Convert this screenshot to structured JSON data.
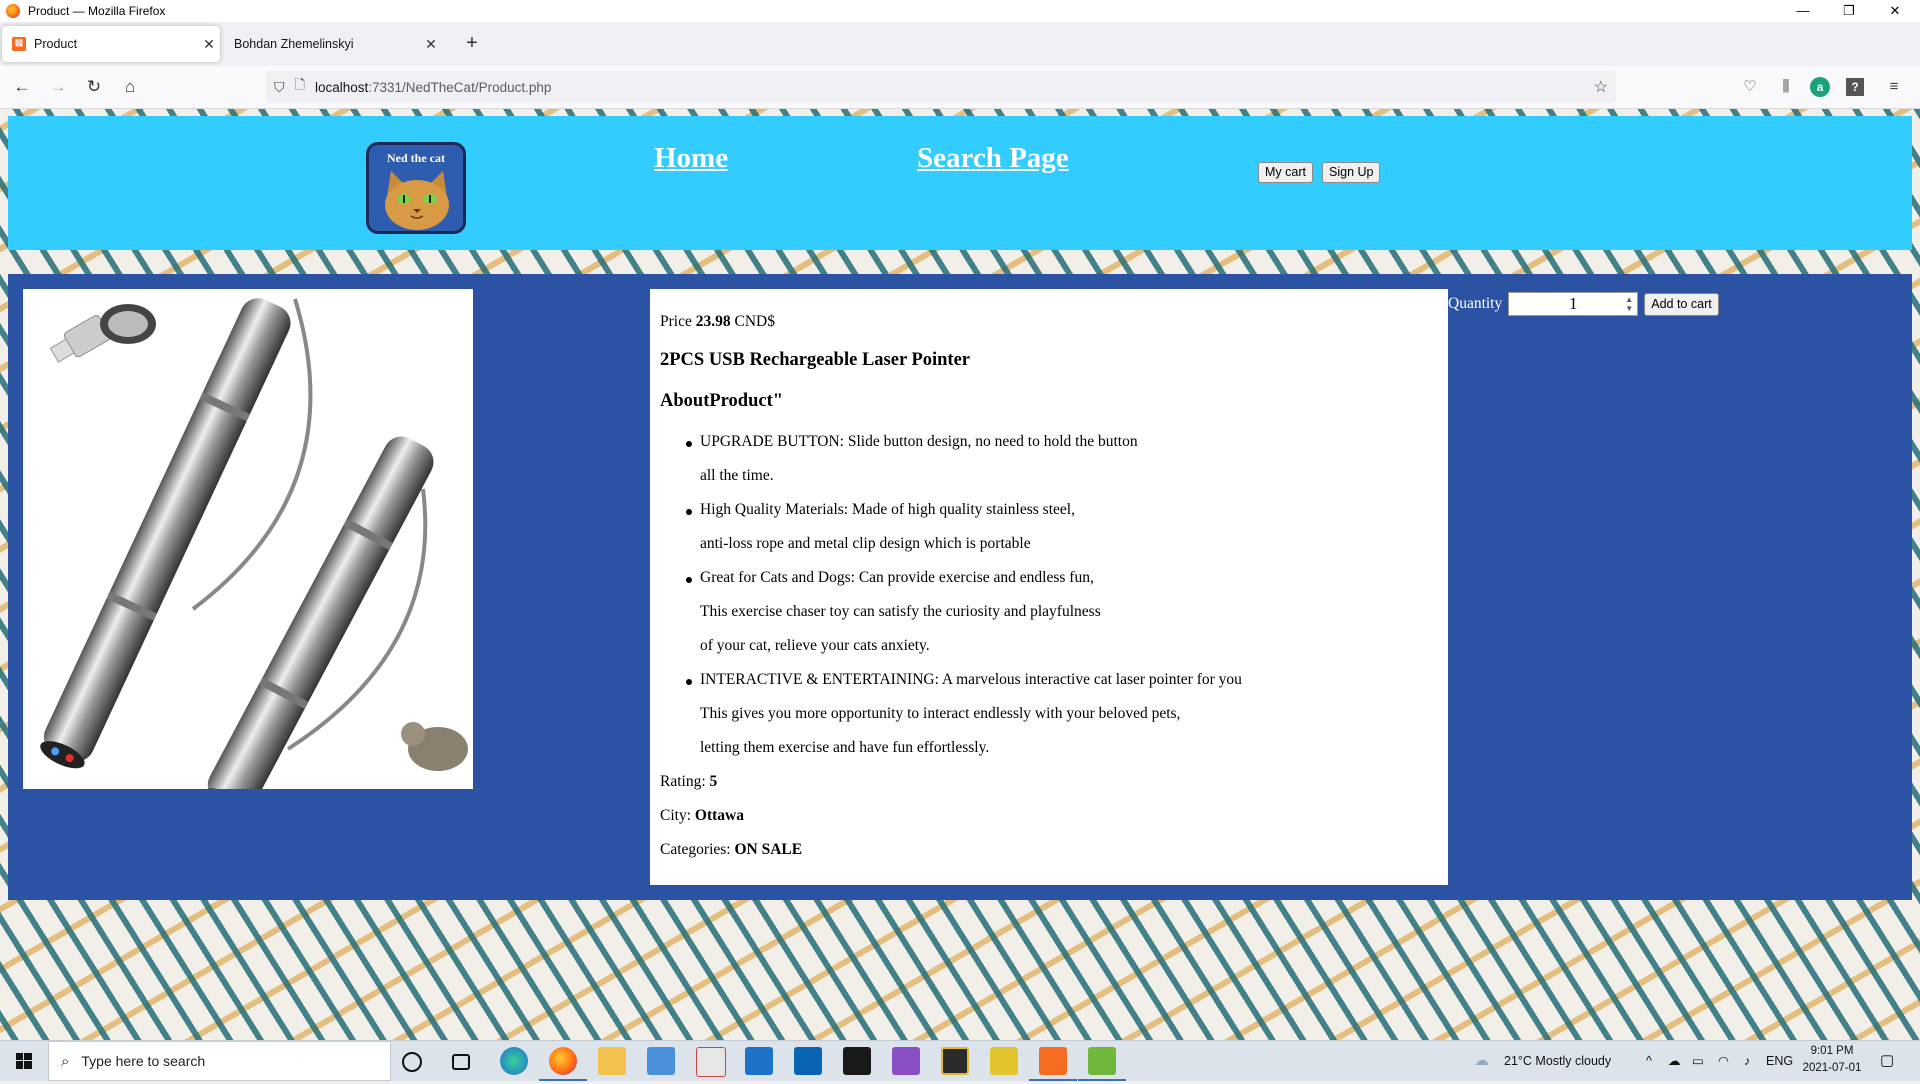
{
  "window": {
    "title": "Product — Mozilla Firefox",
    "controls": {
      "minimize": "—",
      "restore": "❐",
      "close": "✕"
    }
  },
  "tabs": [
    {
      "label": "Product",
      "active": true
    },
    {
      "label": "Bohdan Zhemelinskyi",
      "active": false
    }
  ],
  "navbar": {
    "url_host": "localhost",
    "url_rest": ":7331/NedTheCat/Product.php"
  },
  "site": {
    "logo_text": "Ned the cat",
    "nav": {
      "home": "Home",
      "search": "Search Page"
    },
    "buttons": {
      "cart": "My cart",
      "signup": "Sign Up"
    }
  },
  "product": {
    "price_label": "Price",
    "price_value": "23.98",
    "price_currency": "CND$",
    "name": "2PCS USB Rechargeable Laser Pointer",
    "about_heading": "AboutProduct\"",
    "features": [
      [
        "UPGRADE BUTTON: Slide button design, no need to hold the button",
        "all the time."
      ],
      [
        "High Quality Materials: Made of high quality stainless steel,",
        "anti-loss rope and metal clip design which is portable"
      ],
      [
        "Great for Cats and Dogs: Can provide exercise and endless fun,",
        "This exercise chaser toy can satisfy the curiosity and playfulness",
        "of your cat, relieve your cats anxiety."
      ],
      [
        "INTERACTIVE & ENTERTAINING: A marvelous interactive cat laser pointer for you",
        "This gives you more opportunity to interact endlessly with your beloved pets,",
        "letting them exercise and have fun effortlessly."
      ]
    ],
    "rating_label": "Rating:",
    "rating_value": "5",
    "city_label": "City:",
    "city_value": "Ottawa",
    "categories_label": "Categories:",
    "categories_value": "ON SALE",
    "quantity_label": "Quantity",
    "quantity_value": "1",
    "add_to_cart": "Add to cart"
  },
  "taskbar": {
    "search_placeholder": "Type here to search",
    "weather": "21°C  Mostly cloudy",
    "language": "ENG",
    "time": "9:01 PM",
    "date": "2021-07-01"
  },
  "colors": {
    "header_bg": "#33ccff",
    "product_area_bg": "#2b52a3",
    "logo_bg": "#2e5db0"
  }
}
